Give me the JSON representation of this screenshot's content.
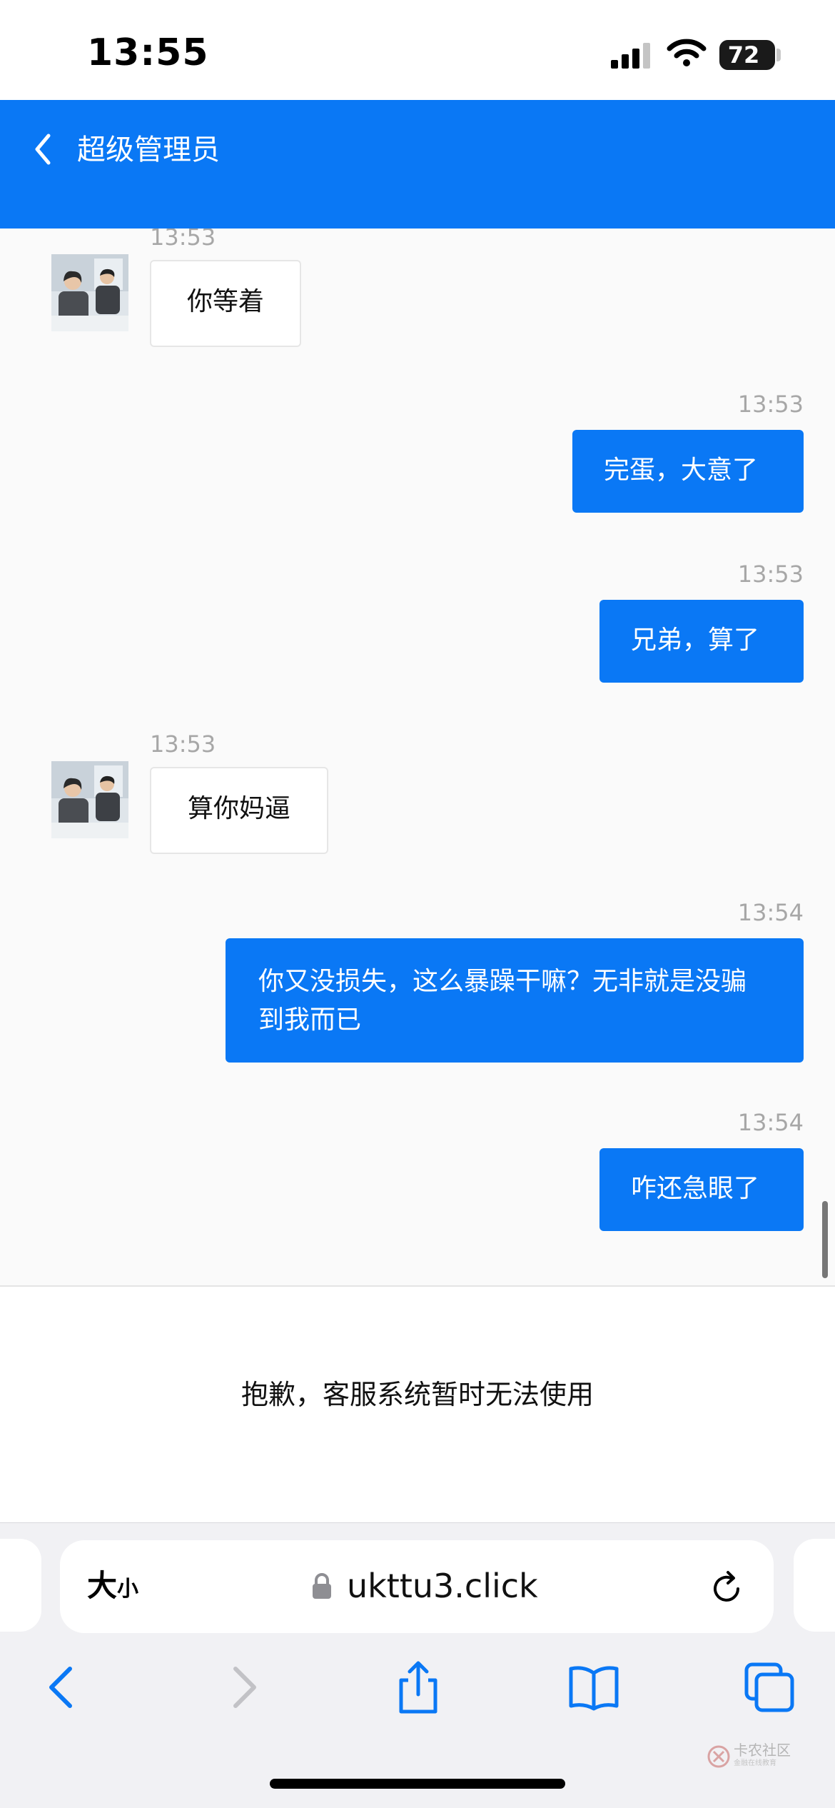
{
  "status_bar": {
    "time": "13:55",
    "battery": "72"
  },
  "header": {
    "title": "超级管理员"
  },
  "messages": [
    {
      "time": "13:53",
      "text": "你等着"
    },
    {
      "time": "13:53",
      "text": "完蛋，大意了"
    },
    {
      "time": "13:53",
      "text": "兄弟，算了"
    },
    {
      "time": "13:53",
      "text": "算你妈逼"
    },
    {
      "time": "13:54",
      "text": "你又没损失，这么暴躁干嘛？无非就是没骗到我而已"
    },
    {
      "time": "13:54",
      "text": "咋还急眼了"
    }
  ],
  "notice": {
    "text": "抱歉，客服系统暂时无法使用"
  },
  "browser": {
    "text_size_big": "大",
    "text_size_small": "小",
    "url": "ukttu3.click"
  },
  "watermark": {
    "text": "卡农社区",
    "sub": "金融在线教育"
  },
  "colors": {
    "accent": "#0a78f5",
    "incoming_bubble": "#ffffff",
    "outgoing_bubble": "#0a78f5"
  }
}
